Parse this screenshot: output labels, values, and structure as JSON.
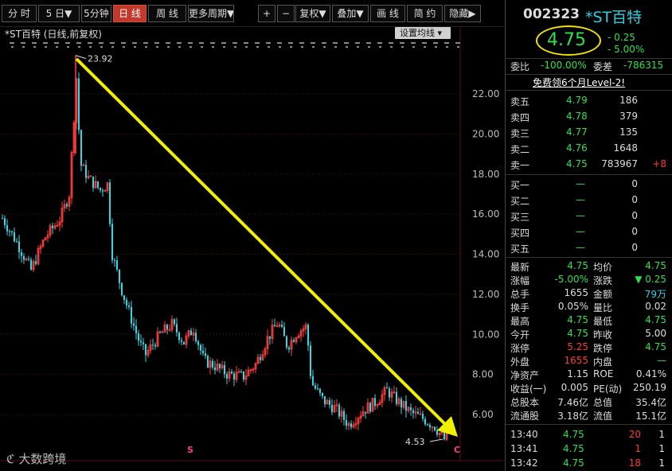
{
  "toolbar": {
    "buttons": [
      "分 时",
      "5 日▼",
      "5分钟",
      "日 线",
      "周 线",
      "更多周期▼",
      "+",
      "−",
      "复权▼",
      "叠加▼",
      "画 线",
      "简 约",
      "隐藏▶"
    ],
    "active_index": 3
  },
  "chart": {
    "title": "*ST百特 (日线,前复权)",
    "ma_button": "设置均线",
    "high_label": "23.92",
    "low_label": "4.53",
    "y_ticks": [
      "22.00",
      "20.00",
      "18.00",
      "16.00",
      "14.00",
      "12.00",
      "10.00",
      "8.00",
      "6.00"
    ],
    "markers": [
      "S",
      "C"
    ],
    "colors": {
      "up": "#ff4040",
      "down": "#2fd9e6",
      "arrow": "#f0f000",
      "grid": "#5a1010"
    }
  },
  "chart_data": {
    "type": "candlestick",
    "title": "*ST百特 (日线,前复权)",
    "y_range": [
      4.53,
      23.92
    ],
    "annotations": [
      "23.92",
      "4.53"
    ],
    "trend_arrow": {
      "from": 23.92,
      "to": 4.53
    }
  },
  "quote": {
    "code": "002323",
    "name": "*ST百特",
    "price": "4.75",
    "change": "- 0.25",
    "change_pct": "- 5.00%",
    "weibi_label": "委比",
    "weibi": "-100.00%",
    "weicha_label": "委差",
    "weicha": "-786315",
    "promo": "免费领6个月Level-2!"
  },
  "sell_levels": [
    {
      "label": "卖五",
      "price": "4.79",
      "vol": "186",
      "delta": ""
    },
    {
      "label": "卖四",
      "price": "4.78",
      "vol": "379",
      "delta": ""
    },
    {
      "label": "卖三",
      "price": "4.77",
      "vol": "135",
      "delta": ""
    },
    {
      "label": "卖二",
      "price": "4.76",
      "vol": "1648",
      "delta": ""
    },
    {
      "label": "卖一",
      "price": "4.75",
      "vol": "783967",
      "delta": "+8"
    }
  ],
  "buy_levels": [
    {
      "label": "买一",
      "price": "—",
      "vol": "0"
    },
    {
      "label": "买二",
      "price": "—",
      "vol": "0"
    },
    {
      "label": "买三",
      "price": "—",
      "vol": "0"
    },
    {
      "label": "买四",
      "price": "—",
      "vol": "0"
    },
    {
      "label": "买五",
      "price": "—",
      "vol": "0"
    }
  ],
  "stats": [
    {
      "l1": "最新",
      "v1": "4.75",
      "c1": "g",
      "l2": "均价",
      "v2": "4.75",
      "c2": "g"
    },
    {
      "l1": "涨幅",
      "v1": "-5.00%",
      "c1": "g",
      "l2": "涨跌",
      "v2": "▼ 0.25",
      "c2": "g"
    },
    {
      "l1": "总手",
      "v1": "1655",
      "c1": "w",
      "l2": "金额",
      "v2": "79万",
      "c2": "c"
    },
    {
      "l1": "换手",
      "v1": "0.05%",
      "c1": "w",
      "l2": "量比",
      "v2": "0.02",
      "c2": "w"
    },
    {
      "l1": "最高",
      "v1": "4.75",
      "c1": "g",
      "l2": "最低",
      "v2": "4.75",
      "c2": "g"
    },
    {
      "l1": "今开",
      "v1": "4.75",
      "c1": "g",
      "l2": "昨收",
      "v2": "5.00",
      "c2": "w"
    },
    {
      "l1": "涨停",
      "v1": "5.25",
      "c1": "r",
      "l2": "跌停",
      "v2": "4.75",
      "c2": "g"
    },
    {
      "l1": "外盘",
      "v1": "1655",
      "c1": "r",
      "l2": "内盘",
      "v2": "—",
      "c2": "g"
    },
    {
      "l1": "净资产",
      "v1": "1.15",
      "c1": "w",
      "l2": "ROE",
      "v2": "0.41%",
      "c2": "w"
    },
    {
      "l1": "收益(一)",
      "v1": "0.005",
      "c1": "w",
      "l2": "PE(动)",
      "v2": "250.19",
      "c2": "w"
    },
    {
      "l1": "总股本",
      "v1": "7.46亿",
      "c1": "w",
      "l2": "总值",
      "v2": "35.4亿",
      "c2": "w"
    },
    {
      "l1": "流通股",
      "v1": "3.18亿",
      "c1": "w",
      "l2": "流值",
      "v2": "15.1亿",
      "c2": "w"
    }
  ],
  "ticks": [
    {
      "time": "13:40",
      "price": "4.75",
      "vol": "20",
      "n": "1"
    },
    {
      "time": "13:41",
      "price": "4.75",
      "vol": "1",
      "n": "1"
    },
    {
      "time": "13:42",
      "price": "4.75",
      "vol": "18",
      "n": "1"
    }
  ],
  "watermark": "大数跨境"
}
